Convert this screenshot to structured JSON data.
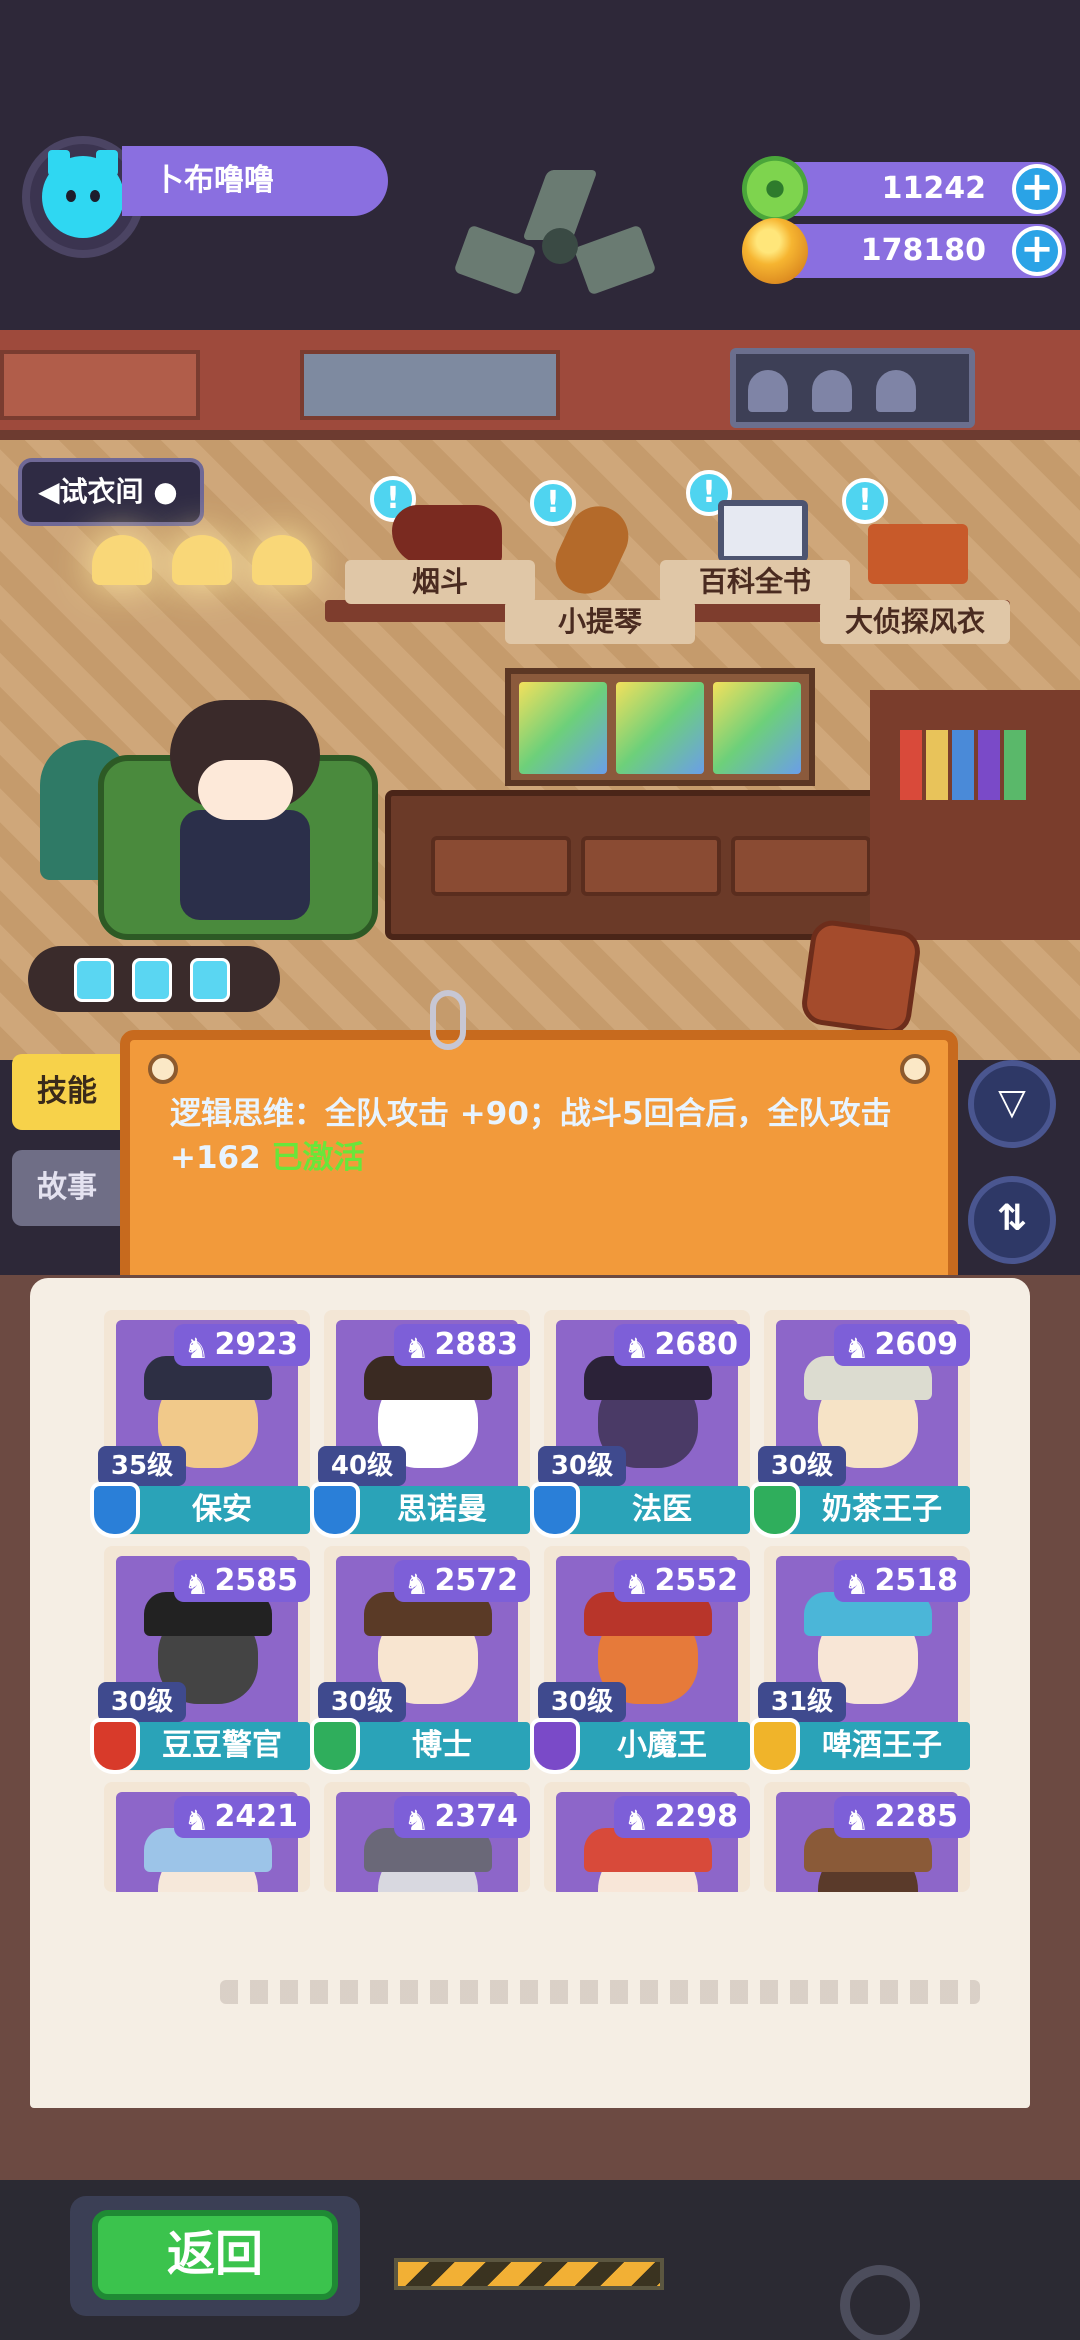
{
  "player": {
    "name": "卜布噜噜",
    "avatar_color": "#2fd7f2"
  },
  "currencies": [
    {
      "icon": "green-gem-icon",
      "value": "11242",
      "color": "#7ed44e"
    },
    {
      "icon": "gold-planet-icon",
      "value": "178180",
      "color": "#f6b531"
    }
  ],
  "room": {
    "back_label": "◀试衣间 ●",
    "items": [
      {
        "label": "烟斗",
        "alert": "!"
      },
      {
        "label": "小提琴",
        "alert": "!"
      },
      {
        "label": "百科全书",
        "alert": "!"
      },
      {
        "label": "大侦探风衣",
        "alert": "!"
      }
    ]
  },
  "tabs": {
    "skill": "技能",
    "story": "故事"
  },
  "skill": {
    "text": "逻辑思维：全队攻击 +90；战斗5回合后，全队攻击 +162 ",
    "status": "已激活"
  },
  "buttons": {
    "filter": "filter-icon",
    "sort": "sort-icon",
    "back": "返回"
  },
  "characters": [
    {
      "name": "保安",
      "level": "35级",
      "power": "2923",
      "badge": "#2a7fd8",
      "head": "#f1c98a",
      "hat": "#2d2f44"
    },
    {
      "name": "思诺曼",
      "level": "40级",
      "power": "2883",
      "badge": "#2a7fd8",
      "head": "#ffffff",
      "hat": "#3a2a22"
    },
    {
      "name": "法医",
      "level": "30级",
      "power": "2680",
      "badge": "#2a7fd8",
      "head": "#4a3a66",
      "hat": "#2b2238"
    },
    {
      "name": "奶茶王子",
      "level": "30级",
      "power": "2609",
      "badge": "#2fae5c",
      "head": "#f6e3c6",
      "hat": "#dcdcd0"
    },
    {
      "name": "豆豆警官",
      "level": "30级",
      "power": "2585",
      "badge": "#d83a2a",
      "head": "#444",
      "hat": "#222"
    },
    {
      "name": "博士",
      "level": "30级",
      "power": "2572",
      "badge": "#2fae5c",
      "head": "#f8e5d0",
      "hat": "#5a3a26"
    },
    {
      "name": "小魔王",
      "level": "30级",
      "power": "2552",
      "badge": "#7a4ac8",
      "head": "#e67a3a",
      "hat": "#b8352a"
    },
    {
      "name": "啤酒王子",
      "level": "31级",
      "power": "2518",
      "badge": "#f0b42a",
      "head": "#f8e6d6",
      "hat": "#4bb6d8"
    },
    {
      "name": "",
      "level": "",
      "power": "2421",
      "badge": "",
      "head": "#f6e8da",
      "hat": "#9cc4e8"
    },
    {
      "name": "",
      "level": "",
      "power": "2374",
      "badge": "",
      "head": "#d8d8e0",
      "hat": "#6a6878"
    },
    {
      "name": "",
      "level": "",
      "power": "2298",
      "badge": "",
      "head": "#f8e6d8",
      "hat": "#d84a3a"
    },
    {
      "name": "",
      "level": "",
      "power": "2285",
      "badge": "",
      "head": "#5a3a2a",
      "hat": "#8a5a38"
    }
  ]
}
